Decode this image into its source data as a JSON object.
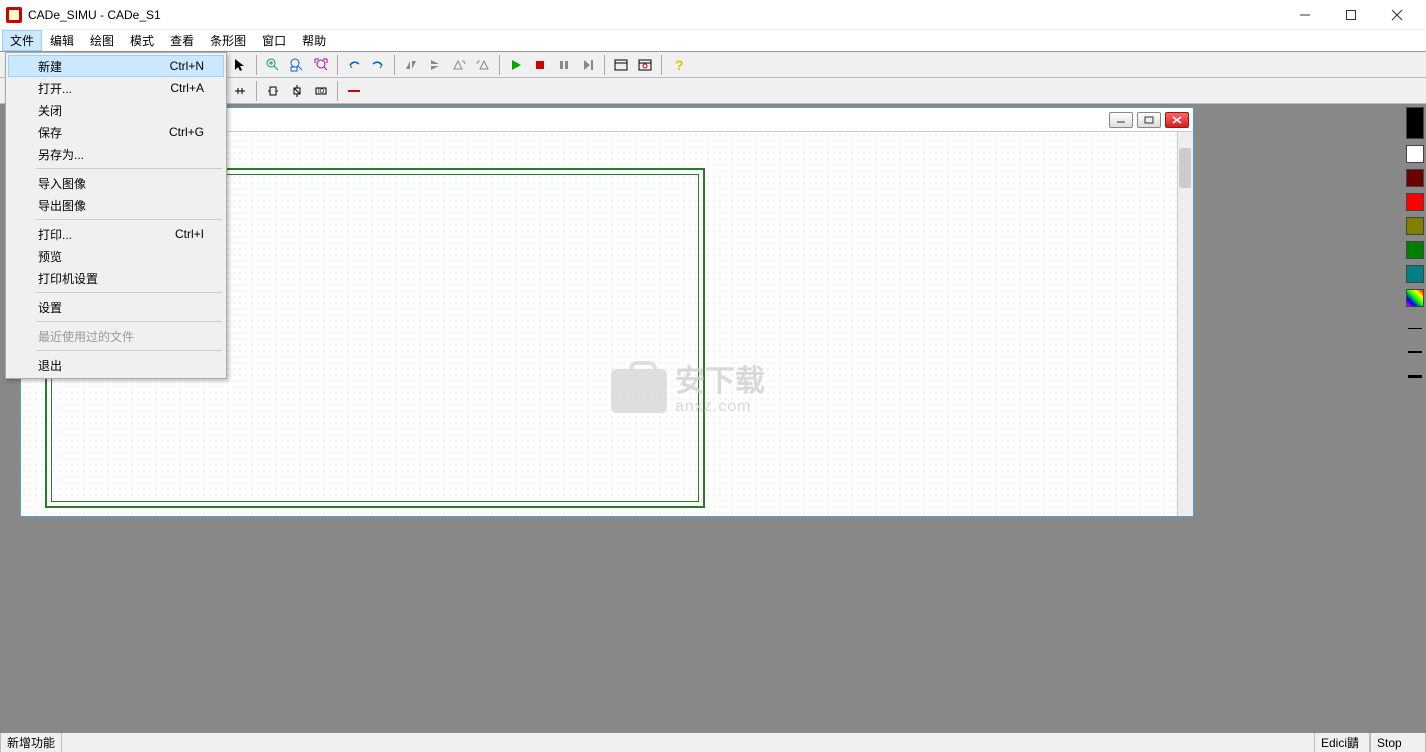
{
  "window": {
    "title": "CADe_SIMU - CADe_S1"
  },
  "menubar": [
    "文件",
    "编辑",
    "绘图",
    "模式",
    "查看",
    "条形图",
    "窗口",
    "帮助"
  ],
  "file_menu": {
    "items": [
      {
        "label": "新建",
        "shortcut": "Ctrl+N",
        "highlight": true
      },
      {
        "label": "打开...",
        "shortcut": "Ctrl+A"
      },
      {
        "label": "关闭",
        "shortcut": ""
      },
      {
        "label": "保存",
        "shortcut": "Ctrl+G"
      },
      {
        "label": "另存为...",
        "shortcut": ""
      }
    ],
    "items2": [
      {
        "label": "导入图像",
        "shortcut": ""
      },
      {
        "label": "导出图像",
        "shortcut": ""
      }
    ],
    "items3": [
      {
        "label": "打印...",
        "shortcut": "Ctrl+I"
      },
      {
        "label": "预览",
        "shortcut": ""
      },
      {
        "label": "打印机设置",
        "shortcut": ""
      }
    ],
    "items4": [
      {
        "label": "设置",
        "shortcut": ""
      }
    ],
    "items5": [
      {
        "label": "最近使用过的文件",
        "shortcut": "",
        "disabled": true
      }
    ],
    "items6": [
      {
        "label": "退出",
        "shortcut": ""
      }
    ]
  },
  "watermark": {
    "line1": "安下载",
    "line2": "anxz.com"
  },
  "palette_colors": [
    "#000000",
    "#ffffff",
    "#6b0000",
    "#ff0000",
    "#808000",
    "#008000",
    "#008080"
  ],
  "palette_rainbow": true,
  "palette_line_weights": [
    1,
    2,
    3
  ],
  "statusbar": {
    "left": "新增功能",
    "right1": "Edici鼱",
    "right2": "Stop"
  }
}
